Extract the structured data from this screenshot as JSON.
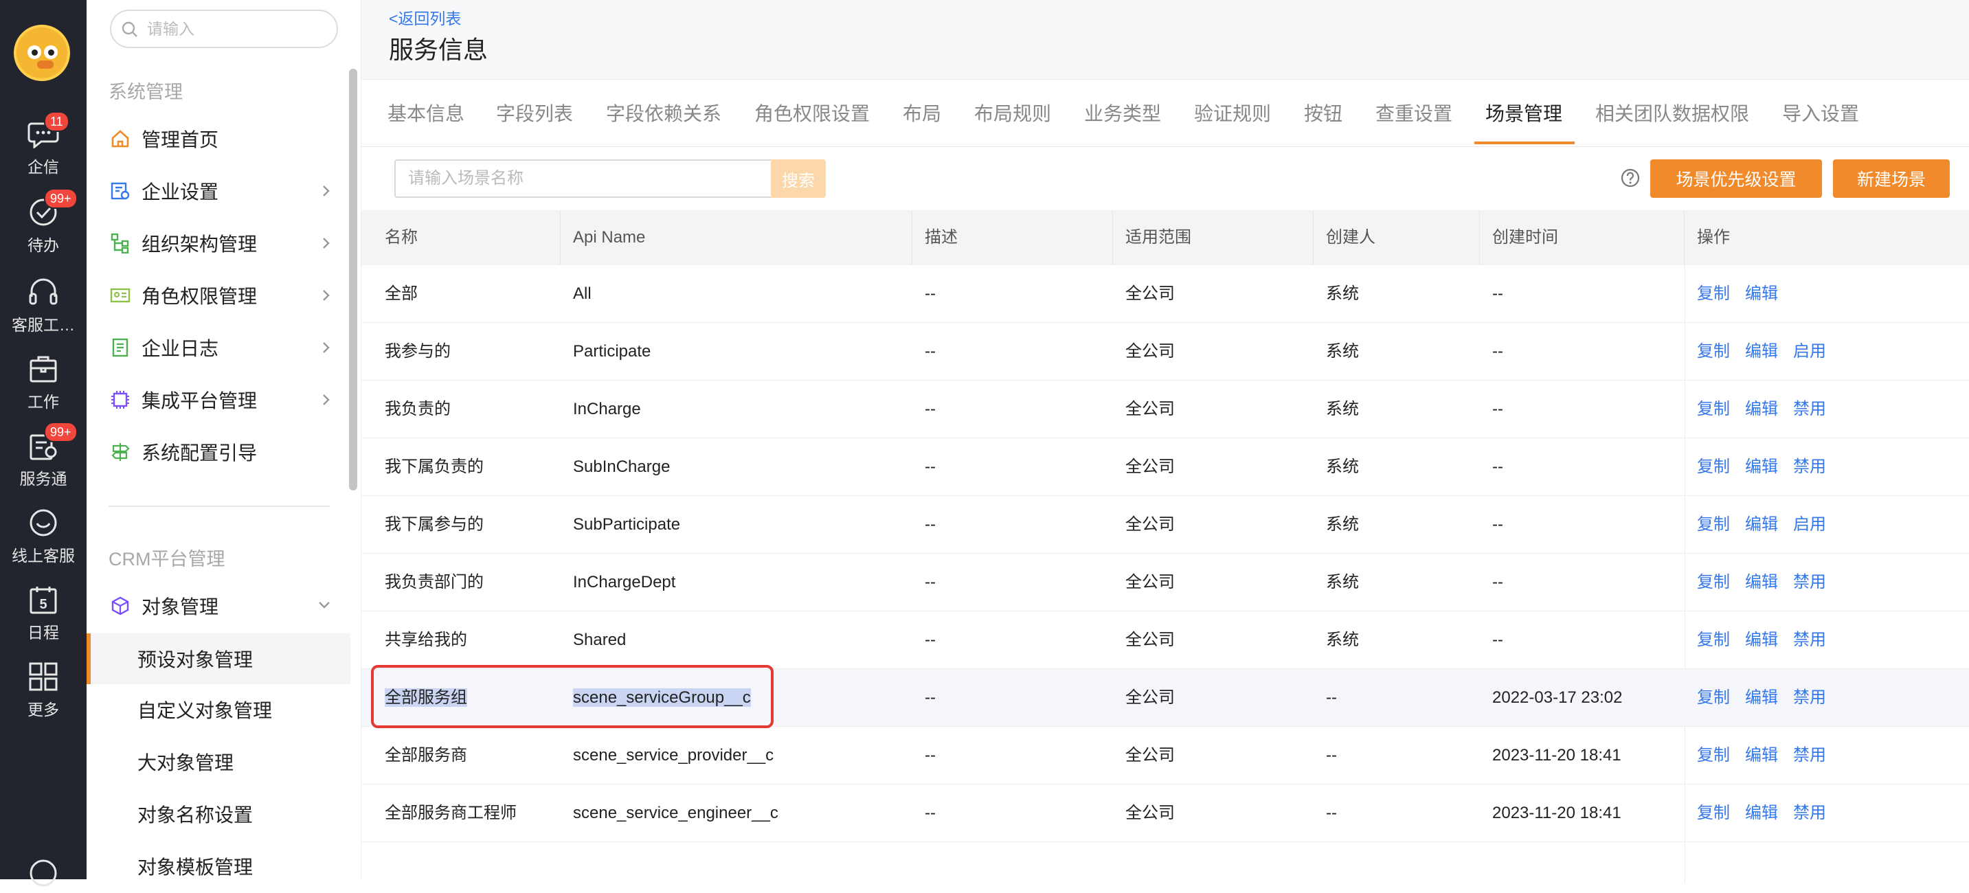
{
  "rail": {
    "items": [
      {
        "label": "企信",
        "icon": "chat-icon",
        "badge": "11"
      },
      {
        "label": "待办",
        "icon": "check-circle-icon",
        "badge": "99+"
      },
      {
        "label": "客服工…",
        "icon": "headset-icon",
        "badge": ""
      },
      {
        "label": "工作",
        "icon": "briefcase-icon",
        "badge": ""
      },
      {
        "label": "服务通",
        "icon": "service-icon",
        "badge": "99+"
      },
      {
        "label": "线上客服",
        "icon": "smile-chat-icon",
        "badge": ""
      },
      {
        "label": "日程",
        "icon": "calendar-icon",
        "badge": "",
        "day": "5"
      },
      {
        "label": "更多",
        "icon": "grid-icon",
        "badge": ""
      }
    ]
  },
  "sidebar": {
    "search_placeholder": "请输入",
    "section1": "系统管理",
    "items": [
      {
        "label": "管理首页",
        "icon": "home-icon"
      },
      {
        "label": "企业设置",
        "icon": "enterprise-settings-icon"
      },
      {
        "label": "组织架构管理",
        "icon": "org-chart-icon"
      },
      {
        "label": "角色权限管理",
        "icon": "role-card-icon"
      },
      {
        "label": "企业日志",
        "icon": "log-icon"
      },
      {
        "label": "集成平台管理",
        "icon": "chip-icon"
      },
      {
        "label": "系统配置引导",
        "icon": "signpost-icon"
      }
    ],
    "section2": "CRM平台管理",
    "object_mgmt": {
      "label": "对象管理",
      "icon": "cube-icon"
    },
    "sub_items": [
      "预设对象管理",
      "自定义对象管理",
      "大对象管理",
      "对象名称设置",
      "对象模板管理"
    ]
  },
  "header": {
    "back_link": "<返回列表",
    "title": "服务信息"
  },
  "tabs": [
    "基本信息",
    "字段列表",
    "字段依赖关系",
    "角色权限设置",
    "布局",
    "布局规则",
    "业务类型",
    "验证规则",
    "按钮",
    "查重设置",
    "场景管理",
    "相关团队数据权限",
    "导入设置"
  ],
  "active_tab": "场景管理",
  "toolbar": {
    "search_placeholder": "请输入场景名称",
    "search_button": "搜索",
    "priority_button": "场景优先级设置",
    "new_button": "新建场景"
  },
  "table": {
    "columns": [
      "名称",
      "Api Name",
      "描述",
      "适用范围",
      "创建人",
      "创建时间",
      "操作"
    ],
    "rows": [
      {
        "name": "全部",
        "api": "All",
        "desc": "--",
        "scope": "全公司",
        "creator": "系统",
        "time": "--",
        "ops": [
          "复制",
          "编辑"
        ]
      },
      {
        "name": "我参与的",
        "api": "Participate",
        "desc": "--",
        "scope": "全公司",
        "creator": "系统",
        "time": "--",
        "ops": [
          "复制",
          "编辑",
          "启用"
        ]
      },
      {
        "name": "我负责的",
        "api": "InCharge",
        "desc": "--",
        "scope": "全公司",
        "creator": "系统",
        "time": "--",
        "ops": [
          "复制",
          "编辑",
          "禁用"
        ]
      },
      {
        "name": "我下属负责的",
        "api": "SubInCharge",
        "desc": "--",
        "scope": "全公司",
        "creator": "系统",
        "time": "--",
        "ops": [
          "复制",
          "编辑",
          "禁用"
        ]
      },
      {
        "name": "我下属参与的",
        "api": "SubParticipate",
        "desc": "--",
        "scope": "全公司",
        "creator": "系统",
        "time": "--",
        "ops": [
          "复制",
          "编辑",
          "启用"
        ]
      },
      {
        "name": "我负责部门的",
        "api": "InChargeDept",
        "desc": "--",
        "scope": "全公司",
        "creator": "系统",
        "time": "--",
        "ops": [
          "复制",
          "编辑",
          "禁用"
        ]
      },
      {
        "name": "共享给我的",
        "api": "Shared",
        "desc": "--",
        "scope": "全公司",
        "creator": "系统",
        "time": "--",
        "ops": [
          "复制",
          "编辑",
          "禁用"
        ]
      },
      {
        "name": "全部服务组",
        "api": "scene_serviceGroup__c",
        "desc": "--",
        "scope": "全公司",
        "creator": "--",
        "time": "2022-03-17 23:02",
        "ops": [
          "复制",
          "编辑",
          "禁用"
        ]
      },
      {
        "name": "全部服务商",
        "api": "scene_service_provider__c",
        "desc": "--",
        "scope": "全公司",
        "creator": "--",
        "time": "2023-11-20 18:41",
        "ops": [
          "复制",
          "编辑",
          "禁用"
        ]
      },
      {
        "name": "全部服务商工程师",
        "api": "scene_service_engineer__c",
        "desc": "--",
        "scope": "全公司",
        "creator": "--",
        "time": "2023-11-20 18:41",
        "ops": [
          "复制",
          "编辑",
          "禁用"
        ]
      }
    ]
  },
  "colors": {
    "accent": "#f08a2a",
    "link": "#3478ea",
    "rail_bg": "#22252d",
    "highlight_border": "#e53935"
  }
}
